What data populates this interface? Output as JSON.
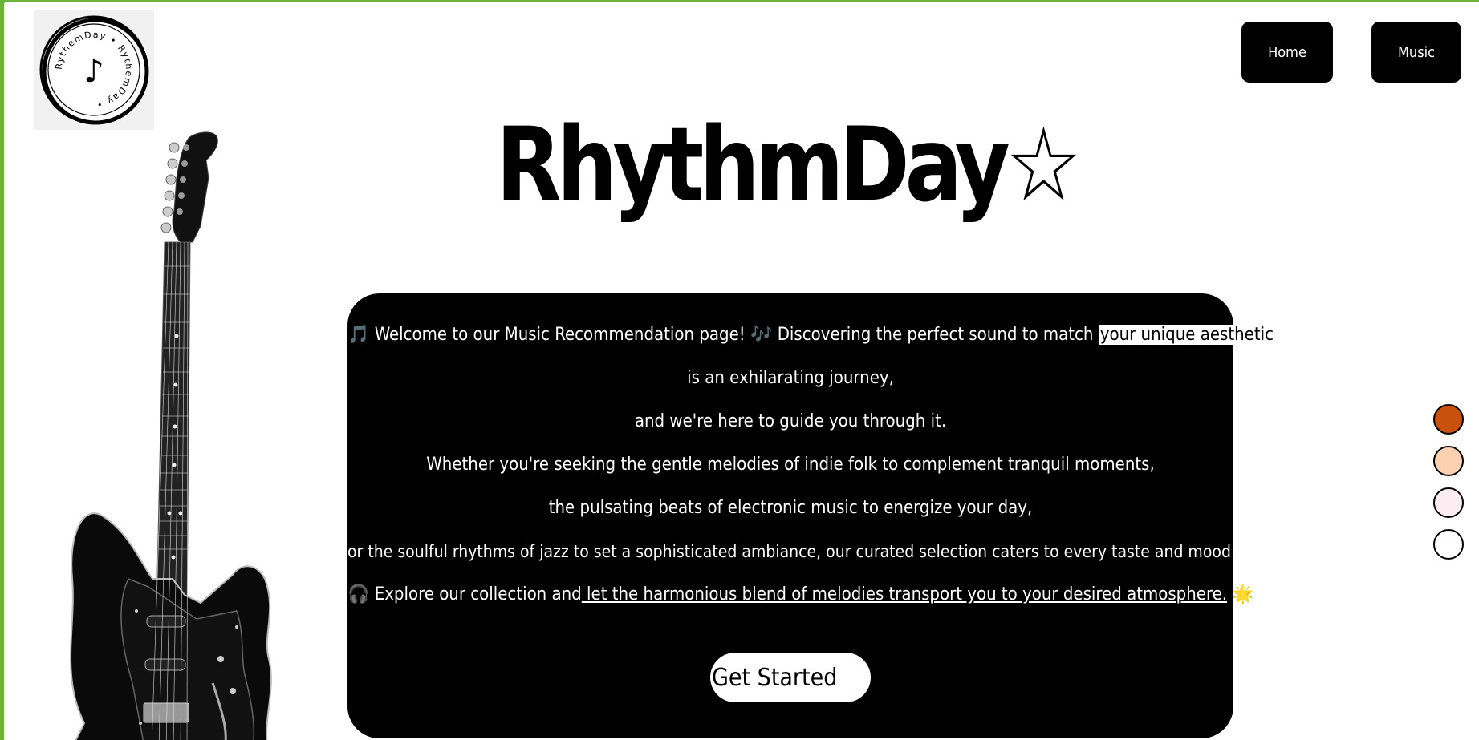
{
  "logo": {
    "ring_text": "RythemDay • RythemDay •",
    "note_glyph": "♪"
  },
  "nav": {
    "home_label": "Home",
    "music_label": "Music"
  },
  "title": "RhythmDay☆",
  "welcome": {
    "line1_icon": "🎵",
    "line1_text_a": " Welcome to our Music Recommendation page! ",
    "line1_icon2": "🎶",
    "line1_text_b": " Discovering the perfect sound to match ",
    "line1_highlight": "your unique aesthetic",
    "line2": "is an exhilarating journey,",
    "line3": "and we're here to guide you through it.",
    "line4": "Whether you're seeking the gentle melodies of indie folk to complement tranquil moments,",
    "line5": "the pulsating beats of electronic music to energize your day,",
    "line6": "or the soulful rhythms of jazz to set a sophisticated ambiance, our curated selection caters to every taste and mood.",
    "line7_icon": "🎧",
    "line7_text_a": " Explore our collection and",
    "line7_underlined": " let the harmonious blend of melodies transport you to your desired atmosphere.",
    "line7_icon2": "🌟",
    "button_label": "Get Started"
  },
  "swatches": [
    {
      "name": "burnt-orange",
      "color": "#c8510d"
    },
    {
      "name": "peach",
      "color": "#fdd0b1"
    },
    {
      "name": "blush",
      "color": "#fdedf2"
    },
    {
      "name": "white",
      "color": "#ffffff"
    }
  ],
  "colors": {
    "accent_border": "#6cb33a",
    "card_background": "#000000"
  }
}
